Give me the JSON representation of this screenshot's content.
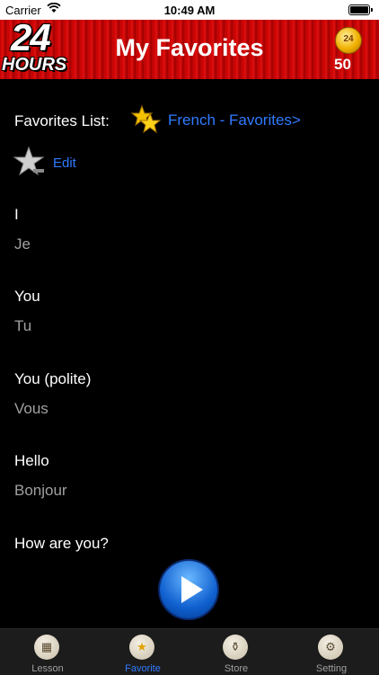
{
  "status_bar": {
    "carrier": "Carrier",
    "time": "10:49 AM"
  },
  "header": {
    "logo_number": "24",
    "logo_text": "HOURS",
    "title": "My Favorites",
    "coin_label": "24",
    "coins": "50"
  },
  "favorites": {
    "label": "Favorites List:",
    "link": "French - Favorites>",
    "edit": "Edit"
  },
  "words": [
    {
      "en": "I",
      "fr": "Je"
    },
    {
      "en": "You",
      "fr": "Tu"
    },
    {
      "en": "You (polite)",
      "fr": "Vous"
    },
    {
      "en": "Hello",
      "fr": "Bonjour"
    },
    {
      "en": "How are you?",
      "fr": ""
    }
  ],
  "tabs": [
    {
      "label": "Lesson",
      "icon": "lesson-icon"
    },
    {
      "label": "Favorite",
      "icon": "star-icon",
      "active": true
    },
    {
      "label": "Store",
      "icon": "store-icon"
    },
    {
      "label": "Setting",
      "icon": "gear-icon"
    }
  ],
  "colors": {
    "header_red": "#d00808",
    "link_blue": "#2f7bff",
    "background": "#000000"
  }
}
